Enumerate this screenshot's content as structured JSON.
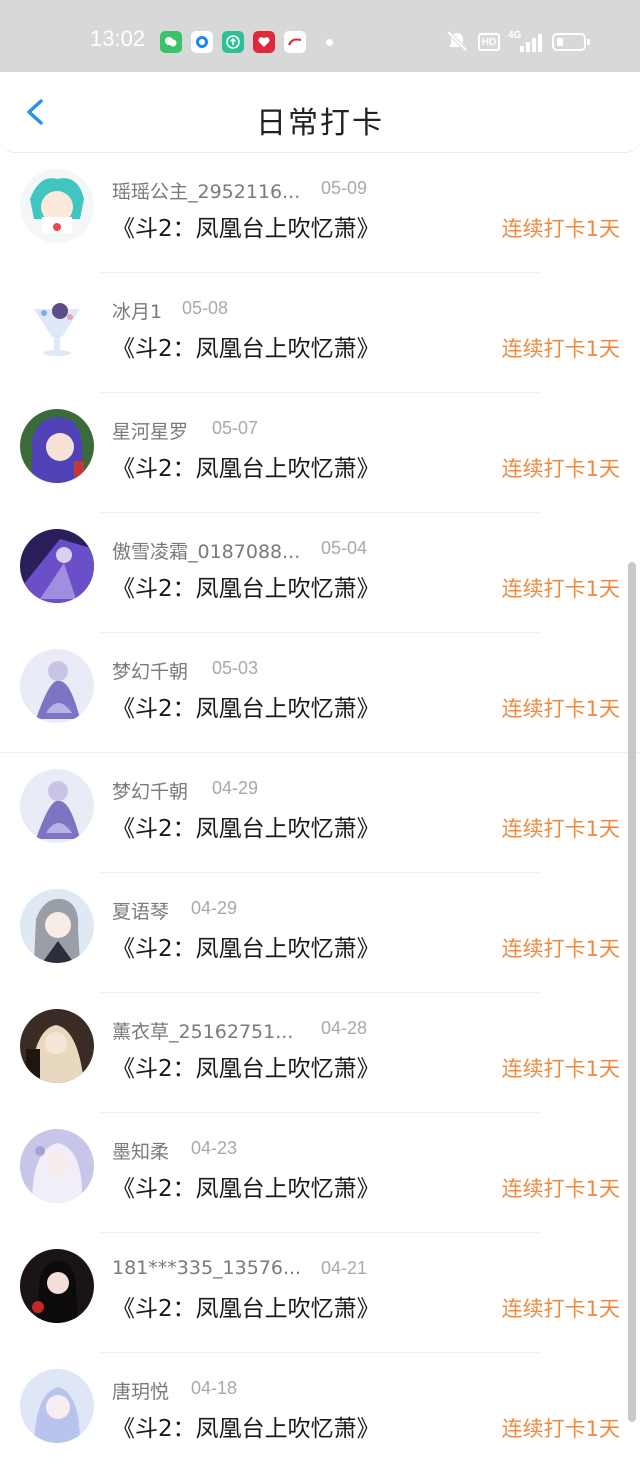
{
  "status_bar": {
    "time": "13:02",
    "app_icons": [
      "wechat-icon",
      "qq-icon",
      "upload-app-icon",
      "gift-app-icon",
      "peoples-daily-icon"
    ],
    "network": "4G",
    "hd_label": "HD"
  },
  "header": {
    "title": "日常打卡",
    "back_icon": "chevron-left-icon"
  },
  "colors": {
    "accent_blue": "#2f90e8",
    "streak_orange": "#f08a3e",
    "name_gray": "#7a7a7a",
    "date_gray": "#a9a9a9"
  },
  "checkins": [
    {
      "name": "瑶瑶公主_2952116...",
      "date": "05-09",
      "book": "《斗2：凤凰台上吹忆萧》",
      "streak": "连续打卡1天"
    },
    {
      "name": "冰月1",
      "date": "05-08",
      "book": "《斗2：凤凰台上吹忆萧》",
      "streak": "连续打卡1天"
    },
    {
      "name": "星河星罗",
      "date": "05-07",
      "book": "《斗2：凤凰台上吹忆萧》",
      "streak": "连续打卡1天"
    },
    {
      "name": "傲雪凌霜_0187088...",
      "date": "05-04",
      "book": "《斗2：凤凰台上吹忆萧》",
      "streak": "连续打卡1天"
    },
    {
      "name": "梦幻千朝",
      "date": "05-03",
      "book": "《斗2：凤凰台上吹忆萧》",
      "streak": "连续打卡1天"
    },
    {
      "name": "梦幻千朝",
      "date": "04-29",
      "book": "《斗2：凤凰台上吹忆萧》",
      "streak": "连续打卡1天"
    },
    {
      "name": "夏语琴",
      "date": "04-29",
      "book": "《斗2：凤凰台上吹忆萧》",
      "streak": "连续打卡1天"
    },
    {
      "name": "薰衣草_25162751...",
      "date": "04-28",
      "book": "《斗2：凤凰台上吹忆萧》",
      "streak": "连续打卡1天"
    },
    {
      "name": "墨知柔",
      "date": "04-23",
      "book": "《斗2：凤凰台上吹忆萧》",
      "streak": "连续打卡1天"
    },
    {
      "name": "181***335_13576...",
      "date": "04-21",
      "book": "《斗2：凤凰台上吹忆萧》",
      "streak": "连续打卡1天"
    },
    {
      "name": "唐玥悦",
      "date": "04-18",
      "book": "《斗2：凤凰台上吹忆萧》",
      "streak": "连续打卡1天"
    }
  ]
}
